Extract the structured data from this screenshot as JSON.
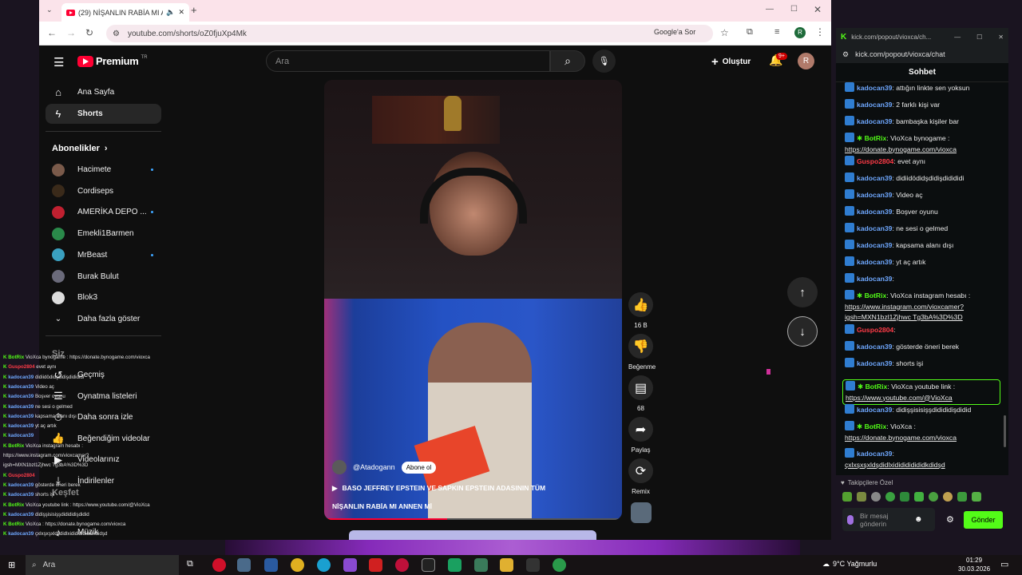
{
  "browser": {
    "tab_title": "(29) NİŞANLIN RABİA MI A",
    "url": "youtube.com/shorts/oZ0fjuXp4Mk",
    "google_label": "Google'a Sor",
    "profile_letter": "R"
  },
  "youtube": {
    "logo": "Premium",
    "logo_sup": "TR",
    "search_placeholder": "Ara",
    "create_label": "Oluştur",
    "notif_count": "9+",
    "avatar_letter": "R"
  },
  "sidebar": {
    "home": "Ana Sayfa",
    "shorts": "Shorts",
    "subs_header": "Abonelikler",
    "subscriptions": [
      {
        "name": "Hacimete",
        "dot": true
      },
      {
        "name": "Cordiseps",
        "dot": false
      },
      {
        "name": "AMERİKA DEPO ...",
        "dot": true
      },
      {
        "name": "Emekli1Barmen",
        "dot": false
      },
      {
        "name": "MrBeast",
        "dot": true
      },
      {
        "name": "Burak Bulut",
        "dot": false
      },
      {
        "name": "Blok3",
        "dot": false
      }
    ],
    "show_more": "Daha fazla göster",
    "you_header": "Siz",
    "you_items": [
      "Geçmiş",
      "Oynatma listeleri",
      "Daha sonra izle",
      "Beğendiğim videolar",
      "Videolarınız",
      "İndirilenler"
    ],
    "explore_header": "Keşfet",
    "explore_items": [
      "Müzik"
    ]
  },
  "short": {
    "channel": "@Atadogann",
    "subscribe": "Abone ol",
    "title_line1": "BASO JEFFREY EPSTEIN VE SAPKIN EPSTEIN ADASININ TÜM",
    "title_line2": "NİŞANLIN RABİA MI ANNEN Mİ",
    "likes": "16 B",
    "dislike_label": "Beğenme",
    "comments": "68",
    "share_label": "Paylaş",
    "remix_label": "Remix"
  },
  "chat": {
    "window_title": "kick.com/popout/vioxca/ch...",
    "url": "kick.com/popout/vioxca/chat",
    "header": "Sohbet",
    "messages": [
      {
        "user": "kadocan39",
        "text": "attığın linkte sen yoksun"
      },
      {
        "user": "kadocan39",
        "text": "2 farklı kişi var"
      },
      {
        "user": "kadocan39",
        "text": "bambaşka kişiler bar"
      },
      {
        "user": "BotRix",
        "text": "VioXca bynogame :",
        "link": "https://donate.bynogame.com/vioxca"
      },
      {
        "user": "Guspo2804",
        "text": "evet aynı"
      },
      {
        "user": "kadocan39",
        "text": "didiidödidşdidişdidididi"
      },
      {
        "user": "kadocan39",
        "text": "Video aç"
      },
      {
        "user": "kadocan39",
        "text": "Boşver oyunu"
      },
      {
        "user": "kadocan39",
        "text": "ne sesi o gelmed"
      },
      {
        "user": "kadocan39",
        "text": "kapsama alanı dışı"
      },
      {
        "user": "kadocan39",
        "text": "yt aç artık"
      },
      {
        "user": "kadocan39",
        "text": ""
      },
      {
        "user": "BotRix",
        "text": "VioXca instagram hesabı :",
        "link": "https://www.instagram.com/vioxcamer?igsh=MXN1bzl1Zjhwc Tg3bA%3D%3D"
      },
      {
        "user": "Guspo2804",
        "text": ""
      },
      {
        "user": "kadocan39",
        "text": "gösterde öneri berek"
      },
      {
        "user": "kadocan39",
        "text": "shorts işi"
      },
      {
        "user": "BotRix",
        "text": "VioXca youtube link :",
        "link": "https://www.youtube.com/@VioXca"
      },
      {
        "user": "kadocan39",
        "text": "didişşisisişşdidididişdidid"
      },
      {
        "user": "BotRix",
        "text": "VioXca :",
        "link": "https://donate.bynogame.com/vioxca"
      },
      {
        "user": "kadocan39",
        "text": "",
        "link": "çxlxşxşxldşdidlxididididididkdidşd"
      }
    ],
    "followers_label": "Takipçilere Özel",
    "input_placeholder": "Bir mesaj gönderin",
    "send": "Gönder"
  },
  "overlay_chat": [
    {
      "user": "BotRix",
      "text": "VioXca bynogame : https://donate.bynogame.com/vioxca"
    },
    {
      "user": "Guspo2804",
      "text": "evet aynı"
    },
    {
      "user": "kadocan39",
      "text": "didiidödidşdidişdidididi"
    },
    {
      "user": "kadocan39",
      "text": "Video aç"
    },
    {
      "user": "kadocan39",
      "text": "Boşver oyunu"
    },
    {
      "user": "kadocan39",
      "text": "ne sesi o gelmed"
    },
    {
      "user": "kadocan39",
      "text": "kapsama alanı dışı"
    },
    {
      "user": "kadocan39",
      "text": "yt aç artık"
    },
    {
      "user": "kadocan39",
      "text": ""
    },
    {
      "user": "BotRix",
      "text": "VioXca instagram hesabı :"
    },
    {
      "user": "",
      "text": "https://www.instagram.com/vioxcamer?"
    },
    {
      "user": "",
      "text": "igsh=MXN1bzl1Zjhwc Tg3bA%3D%3D"
    },
    {
      "user": "Guspo2804",
      "text": ""
    },
    {
      "user": "kadocan39",
      "text": "gösterde öneri berek"
    },
    {
      "user": "kadocan39",
      "text": "shorts işi"
    },
    {
      "user": "BotRix",
      "text": "VioXca youtube link : https://www.youtube.com/@VioXca"
    },
    {
      "user": "kadocan39",
      "text": "didişşisisişşdidididişdidid"
    },
    {
      "user": "BotRix",
      "text": "VioXca : https://donate.bynogame.com/vioxca"
    },
    {
      "user": "kadocan39",
      "text": "çxlxşxşxldşdidlxididididididkdidşd"
    }
  ],
  "taskbar": {
    "search": "Ara",
    "weather": "9°C  Yağmurlu",
    "time": "01:29",
    "date": "30.03.2026"
  },
  "colors": {
    "kick_green": "#53fc18",
    "yt_red": "#ff0033",
    "link_blue": "#3ea6ff"
  }
}
